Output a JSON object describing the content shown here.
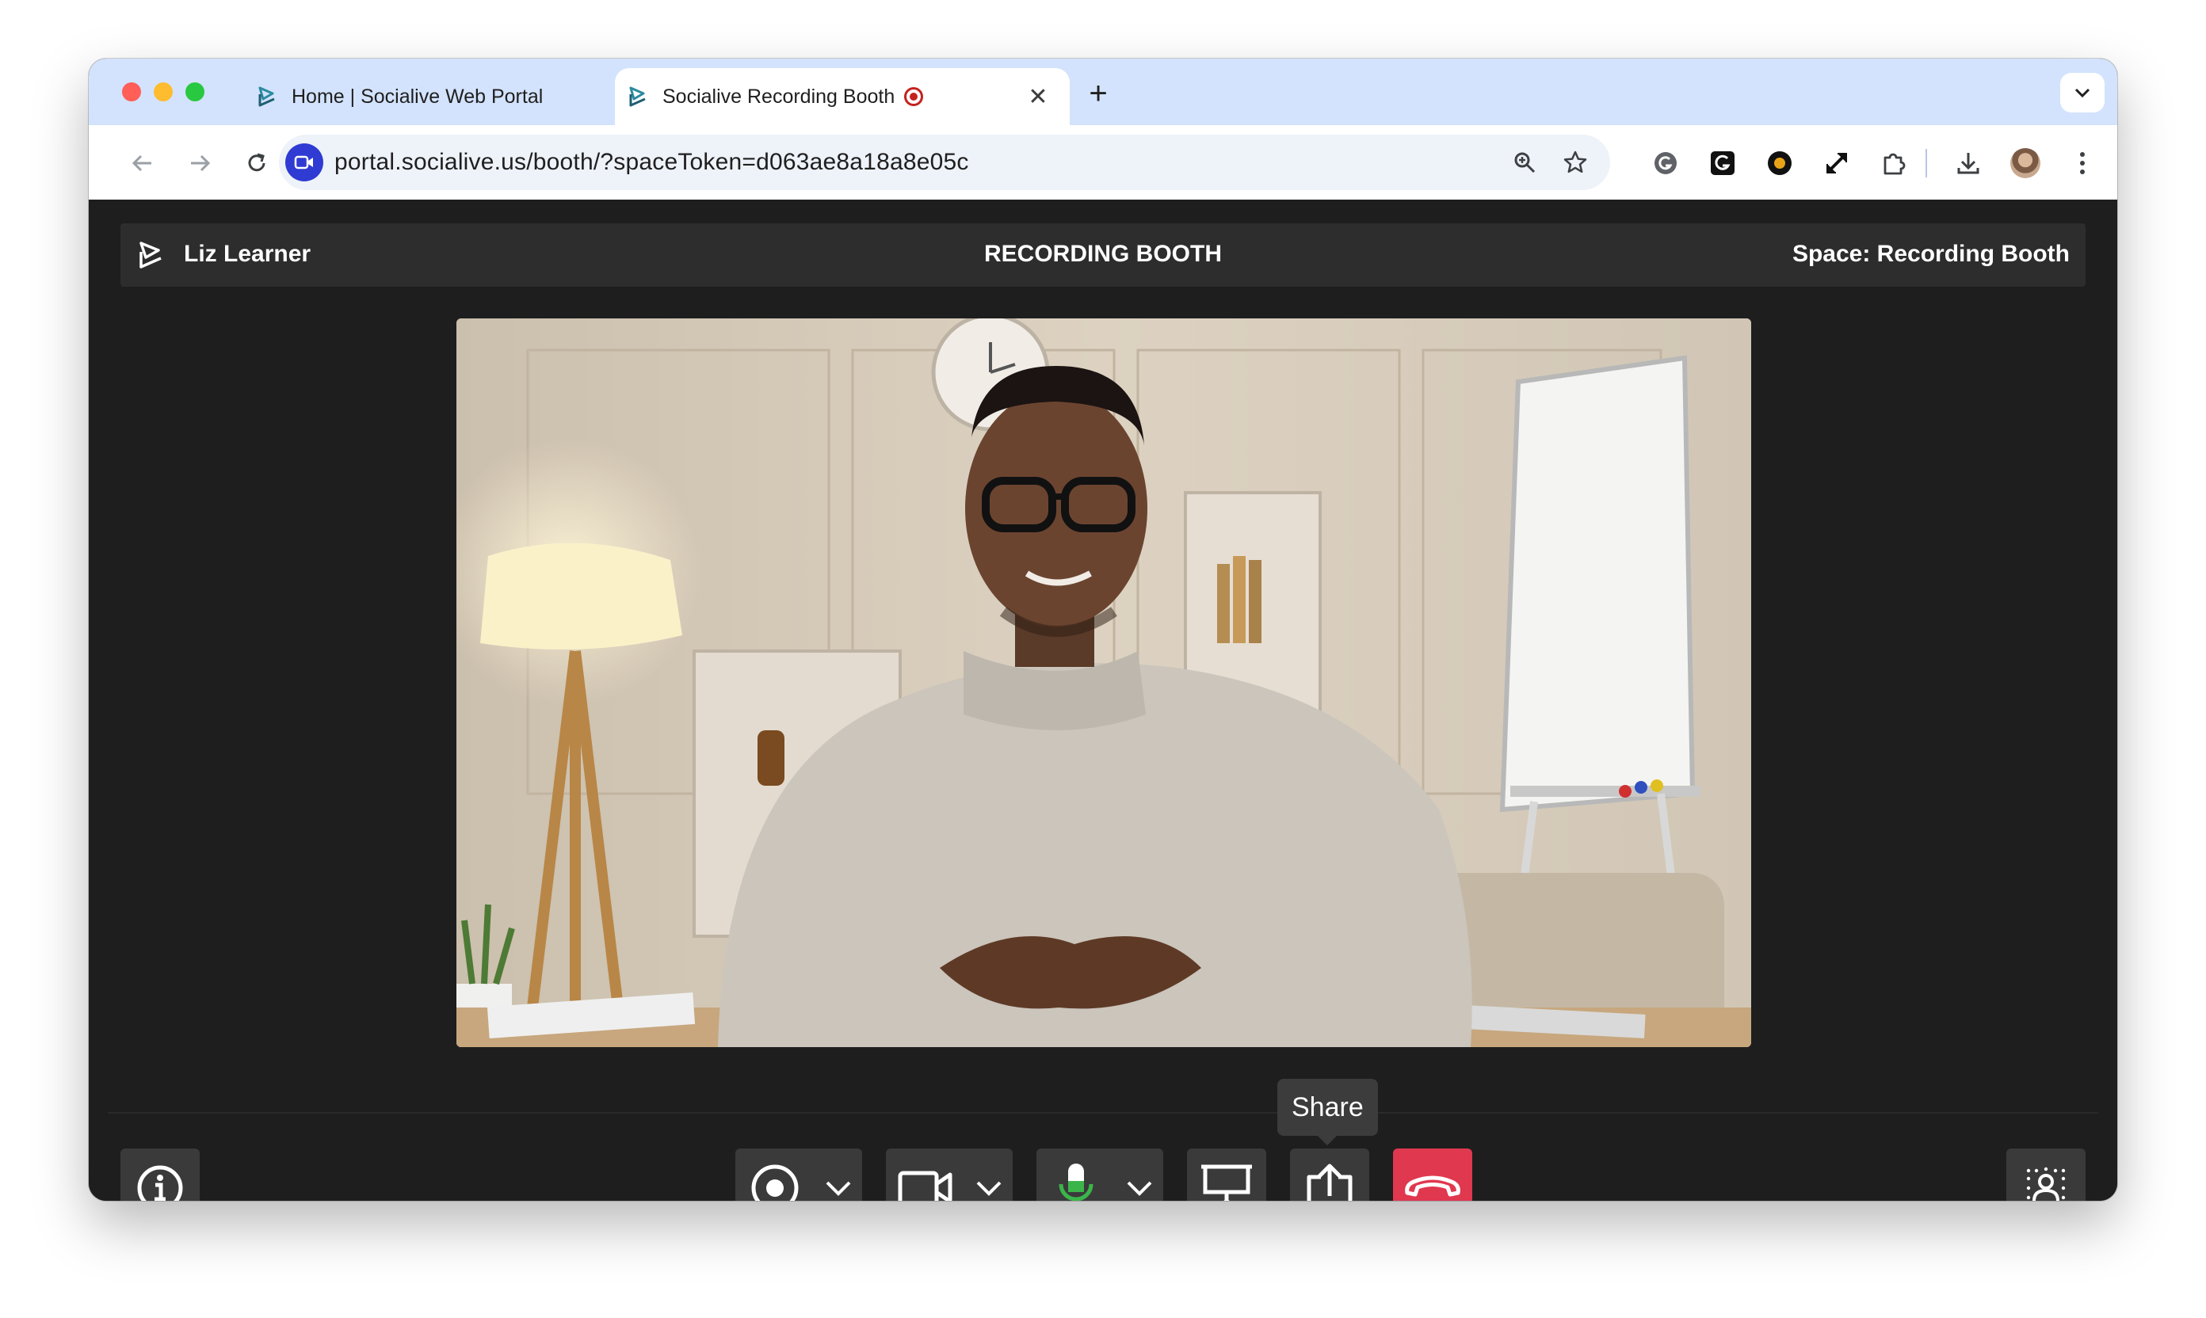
{
  "browser": {
    "tabs": [
      {
        "title": "Home | Socialive Web Portal",
        "active": false
      },
      {
        "title": "Socialive Recording Booth",
        "active": true,
        "recording": true
      }
    ],
    "new_tab": "+",
    "address_bar": {
      "url": "portal.socialive.us/booth/?spaceToken=d063ae8a18a8e05c"
    },
    "toolbar_icons": [
      "back-icon",
      "forward-icon",
      "reload-icon",
      "zoom-icon",
      "bookmark-star-icon",
      "grammarly-icon",
      "extension-g-icon",
      "extension-info-icon",
      "expand-icon",
      "extensions-puzzle-icon",
      "download-icon",
      "profile-avatar",
      "menu-kebab-icon"
    ]
  },
  "app": {
    "user_name": "Liz Learner",
    "page_title": "RECORDING BOOTH",
    "space_label": "Space: Recording Booth",
    "video_feed": "camera-preview",
    "controls": {
      "info": "info-icon",
      "record": "record-icon",
      "camera": "video-camera-icon",
      "microphone": "microphone-icon",
      "present": "presentation-icon",
      "share": "share-icon",
      "hang_up": "phone-hangup-icon",
      "background": "background-blur-icon"
    },
    "tooltip": "Share"
  },
  "colors": {
    "tabstrip": "#d3e3fd",
    "app_bg": "#1e1e1f",
    "control_bg": "#3a3a3b",
    "hangup": "#e0384f",
    "mic_active": "#3bb54a",
    "site_icon": "#2f3bd3"
  }
}
